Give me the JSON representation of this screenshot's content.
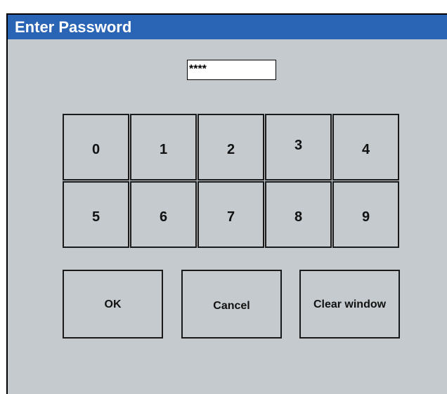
{
  "window": {
    "title": "Enter Password",
    "title_bar_color": "#2a64b5",
    "background_color": "#c4cace"
  },
  "password": {
    "value": "****"
  },
  "keypad": {
    "keys": [
      "0",
      "1",
      "2",
      "3",
      "4",
      "5",
      "6",
      "7",
      "8",
      "9"
    ]
  },
  "actions": {
    "ok_label": "OK",
    "cancel_label": "Cancel",
    "clear_label": "Clear window"
  }
}
